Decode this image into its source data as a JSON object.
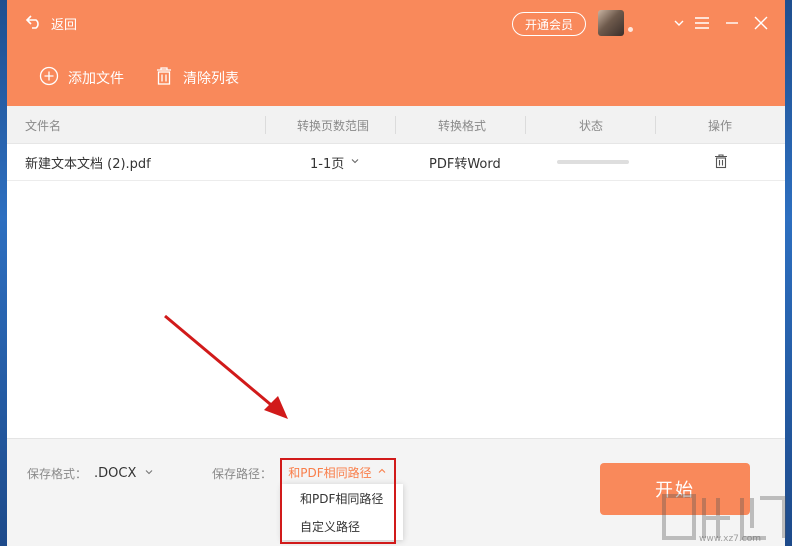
{
  "header": {
    "back_label": "返回",
    "vip_label": "开通会员"
  },
  "toolbar": {
    "add_label": "添加文件",
    "clear_label": "清除列表"
  },
  "table": {
    "columns": [
      "文件名",
      "转换页数范围",
      "转换格式",
      "状态",
      "操作"
    ],
    "rows": [
      {
        "filename": "新建文本文档 (2).pdf",
        "page_range": "1-1页",
        "format": "PDF转Word",
        "progress": 0
      }
    ]
  },
  "footer": {
    "format_label": "保存格式：",
    "format_value": ".DOCX",
    "path_label": "保存路径：",
    "path_value": "和PDF相同路径",
    "path_options": [
      "和PDF相同路径",
      "自定义路径"
    ],
    "start_label": "开始"
  },
  "watermark": {
    "url": "www.xz7.com"
  },
  "colors": {
    "accent": "#f9895b",
    "highlight": "#d11a1a",
    "path_text": "#f97e4a"
  },
  "icons": [
    "back-arrow-icon",
    "chevron-down-icon",
    "menu-icon",
    "minimize-icon",
    "close-icon",
    "plus-circle-icon",
    "trash-icon",
    "chevron-up-icon"
  ]
}
